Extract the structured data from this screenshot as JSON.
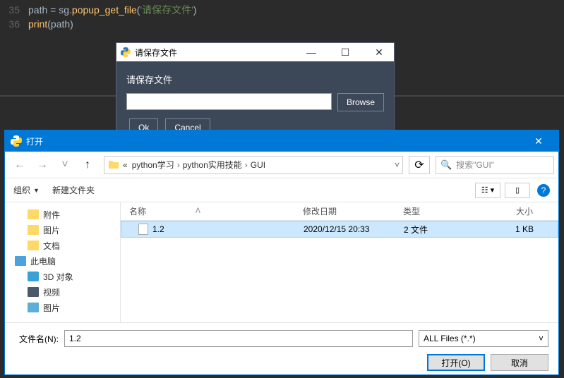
{
  "code": {
    "line1_num": "35",
    "line1_var": "path",
    "line1_eq": " = ",
    "line1_mod": "sg",
    "line1_dot": ".",
    "line1_func": "popup_get_file",
    "line1_paren_o": "(",
    "line1_str": "'请保存文件'",
    "line1_paren_c": ")",
    "line2_num": "36",
    "line2_func": "print",
    "line2_paren_o": "(",
    "line2_arg": "path",
    "line2_paren_c": ")"
  },
  "popup": {
    "title": "请保存文件",
    "label": "请保存文件",
    "input_value": "",
    "browse": "Browse",
    "ok": "Ok",
    "cancel": "Cancel"
  },
  "dialog": {
    "title": "打开",
    "breadcrumb": {
      "prefix": "«",
      "p1": "python学习",
      "p2": "python实用技能",
      "p3": "GUI"
    },
    "search_placeholder": "搜索\"GUI\"",
    "toolbar": {
      "organize": "组织",
      "new_folder": "新建文件夹"
    },
    "sidebar": {
      "items": [
        {
          "label": "附件",
          "level": 2,
          "icon": "folder"
        },
        {
          "label": "图片",
          "level": 2,
          "icon": "folder"
        },
        {
          "label": "文档",
          "level": 2,
          "icon": "folder"
        },
        {
          "label": "此电脑",
          "level": 1,
          "icon": "pc"
        },
        {
          "label": "3D 对象",
          "level": 2,
          "icon": "obj3d"
        },
        {
          "label": "视频",
          "level": 2,
          "icon": "video"
        },
        {
          "label": "图片",
          "level": 2,
          "icon": "img"
        }
      ]
    },
    "columns": {
      "name": "名称",
      "date": "修改日期",
      "type": "类型",
      "size": "大小"
    },
    "files": [
      {
        "name": "1.2",
        "date": "2020/12/15 20:33",
        "type": "2 文件",
        "size": "1 KB",
        "selected": true
      }
    ],
    "filename_label": "文件名(N):",
    "filename_value": "1.2",
    "filter": "ALL Files (*.*)",
    "open_btn": "打开(O)",
    "cancel_btn": "取消"
  }
}
